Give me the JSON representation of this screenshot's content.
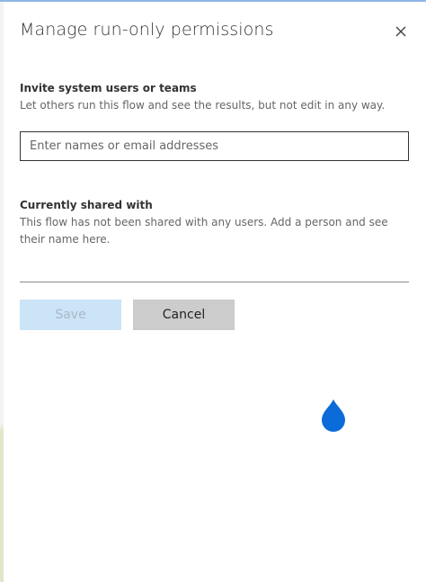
{
  "dialog": {
    "title": "Manage run-only permissions",
    "close_icon": "close-icon"
  },
  "invite": {
    "heading": "Invite system users or teams",
    "description": "Let others run this flow and see the results, but not edit in any way.",
    "input": {
      "value": "",
      "placeholder": "Enter names or email addresses"
    }
  },
  "shared": {
    "heading": "Currently shared with",
    "description": "This flow has not been shared with any users. Add a person and see their name here."
  },
  "actions": {
    "save_label": "Save",
    "cancel_label": "Cancel"
  },
  "colors": {
    "save_bg": "#cce4f7",
    "cancel_bg": "#cccccc",
    "accent": "#0b6bd8"
  },
  "icons": {
    "pointer": "location-pin-icon"
  }
}
